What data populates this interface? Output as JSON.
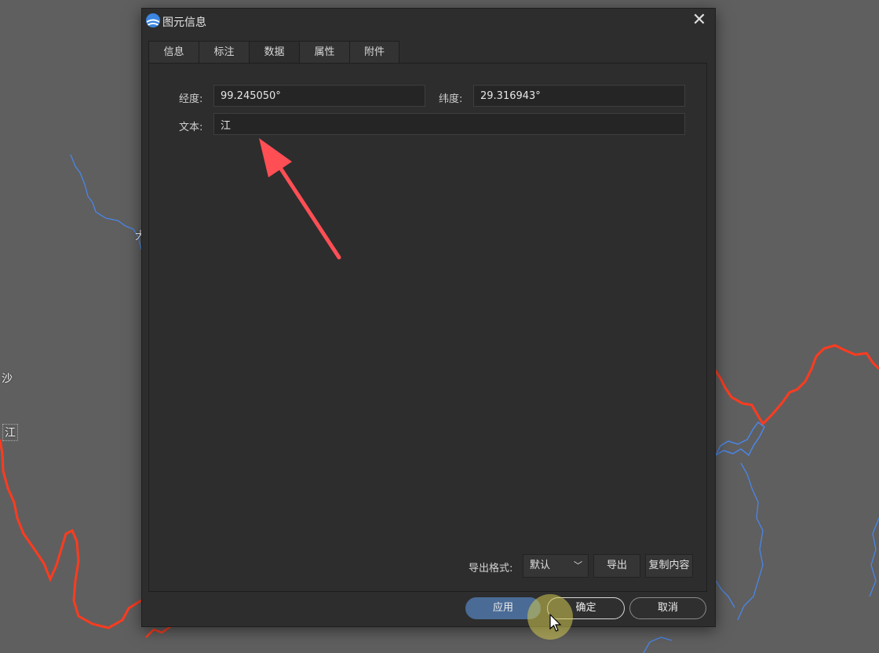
{
  "window": {
    "title": "图元信息"
  },
  "tabs": [
    {
      "label": "信息",
      "active": false
    },
    {
      "label": "标注",
      "active": false
    },
    {
      "label": "数据",
      "active": true
    },
    {
      "label": "属性",
      "active": false
    },
    {
      "label": "附件",
      "active": false
    }
  ],
  "fields": {
    "longitude": {
      "label": "经度:",
      "value": "99.245050°"
    },
    "latitude": {
      "label": "纬度:",
      "value": "29.316943°"
    },
    "text": {
      "label": "文本:",
      "value": "江"
    }
  },
  "export": {
    "format_label": "导出格式:",
    "format_selected": "默认",
    "export_button": "导出",
    "copy_button": "复制内容"
  },
  "footer": {
    "apply": "应用",
    "ok": "确定",
    "cancel": "取消"
  },
  "map_labels": [
    "大",
    "沙",
    "江"
  ],
  "colors": {
    "map_background": "#5f5f5f",
    "river": "#4a86e8",
    "boundary_line": "#ff3b1f",
    "dialog_background": "#2d2d2d",
    "apply_button": "#4a6b96",
    "annotation_arrow": "#ff4f55",
    "click_highlight": "#d2c850"
  },
  "icons": [
    "app-logo-icon",
    "close-icon",
    "chevron-down-icon",
    "mouse-cursor-icon",
    "annotation-arrow"
  ]
}
